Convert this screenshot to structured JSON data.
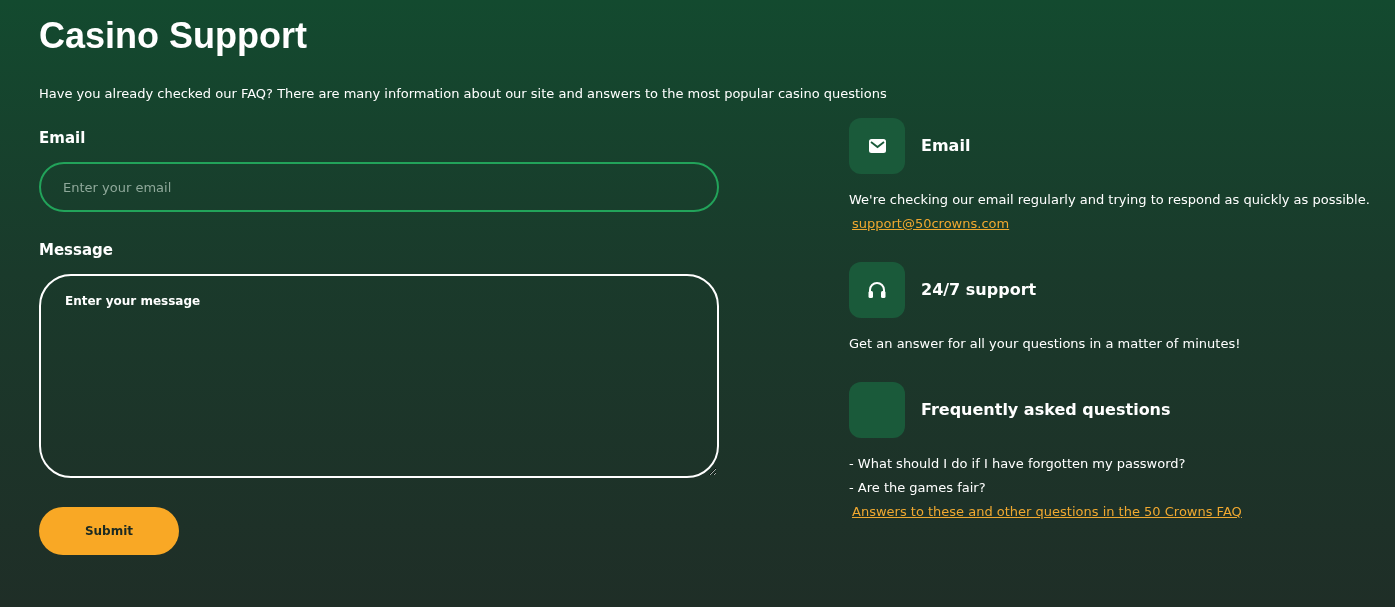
{
  "title": "Casino Support",
  "intro": "Have you already checked our FAQ? There are many information about our site and answers to the most popular casino questions",
  "form": {
    "fields": [
      {
        "kind": "input",
        "label": "Email",
        "placeholder": "Enter your email",
        "focused": true
      },
      {
        "kind": "textarea",
        "label": "Message",
        "placeholder": "Enter your message",
        "focused": false
      }
    ],
    "submit": "Submit"
  },
  "contacts": [
    {
      "kind": "mail",
      "title": "Email",
      "lines": [
        "We're checking our email regularly and trying to respond as quickly as possible."
      ],
      "link": "support@50crowns.com"
    },
    {
      "kind": "headset",
      "title": "24/7 support",
      "lines": [
        "Get an answer for all your questions in a matter of minutes!"
      ]
    },
    {
      "kind": "blank",
      "title": "Frequently asked questions",
      "lines": [
        "- What should I do if I have forgotten my password?",
        "- Are the games fair?"
      ],
      "link": "Answers to these and other questions in the 50 Crowns FAQ"
    }
  ]
}
